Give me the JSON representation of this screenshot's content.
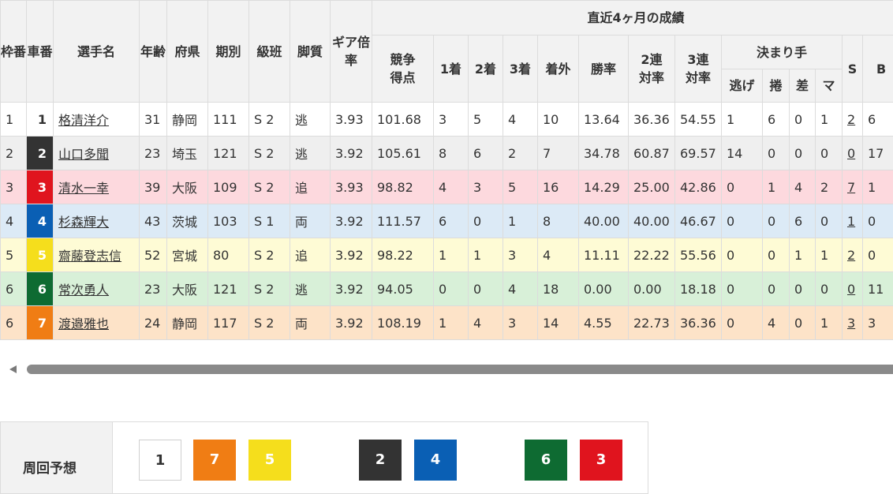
{
  "headers": {
    "waku": "枠番",
    "car": "車番",
    "name": "選手名",
    "age": "年齢",
    "pref": "府県",
    "term": "期別",
    "class": "級班",
    "leg": "脚質",
    "gear": "ギア倍率",
    "recent": "直近4ヶ月の成績",
    "score": "競争得点",
    "first": "1着",
    "second": "2着",
    "third": "3着",
    "out": "着外",
    "win_rate": "勝率",
    "rate2": "2連対率",
    "rate3": "3連対率",
    "kimarite": "決まり手",
    "nige": "逃げ",
    "makuri": "捲",
    "sashi": "差",
    "mark": "マ",
    "s": "S",
    "b": "B"
  },
  "racers": [
    {
      "waku": "1",
      "car": "1",
      "car_bg": "#ffffff",
      "car_fg": "#333333",
      "name": "格清洋介",
      "age": "31",
      "pref": "静岡",
      "term": "111",
      "class": "S 2",
      "leg": "逃",
      "gear": "3.93",
      "score": "101.68",
      "first": "3",
      "second": "5",
      "third": "4",
      "out": "10",
      "win_rate": "13.64",
      "rate2": "36.36",
      "rate3": "54.55",
      "nige": "1",
      "makuri": "6",
      "sashi": "0",
      "mark": "1",
      "s": "2",
      "b": "6"
    },
    {
      "waku": "2",
      "car": "2",
      "car_bg": "#333333",
      "car_fg": "#ffffff",
      "name": "山口多聞",
      "age": "23",
      "pref": "埼玉",
      "term": "121",
      "class": "S 2",
      "leg": "逃",
      "gear": "3.92",
      "score": "105.61",
      "first": "8",
      "second": "6",
      "third": "2",
      "out": "7",
      "win_rate": "34.78",
      "rate2": "60.87",
      "rate3": "69.57",
      "nige": "14",
      "makuri": "0",
      "sashi": "0",
      "mark": "0",
      "s": "0",
      "b": "17"
    },
    {
      "waku": "3",
      "car": "3",
      "car_bg": "#e0141e",
      "car_fg": "#ffffff",
      "name": "清水一幸",
      "age": "39",
      "pref": "大阪",
      "term": "109",
      "class": "S 2",
      "leg": "追",
      "gear": "3.93",
      "score": "98.82",
      "first": "4",
      "second": "3",
      "third": "5",
      "out": "16",
      "win_rate": "14.29",
      "rate2": "25.00",
      "rate3": "42.86",
      "nige": "0",
      "makuri": "1",
      "sashi": "4",
      "mark": "2",
      "s": "7",
      "b": "1"
    },
    {
      "waku": "4",
      "car": "4",
      "car_bg": "#0a5fb4",
      "car_fg": "#ffffff",
      "name": "杉森輝大",
      "age": "43",
      "pref": "茨城",
      "term": "103",
      "class": "S 1",
      "leg": "両",
      "gear": "3.92",
      "score": "111.57",
      "first": "6",
      "second": "0",
      "third": "1",
      "out": "8",
      "win_rate": "40.00",
      "rate2": "40.00",
      "rate3": "46.67",
      "nige": "0",
      "makuri": "0",
      "sashi": "6",
      "mark": "0",
      "s": "1",
      "b": "0"
    },
    {
      "waku": "5",
      "car": "5",
      "car_bg": "#f5de1c",
      "car_fg": "#ffffff",
      "name": "齋藤登志信",
      "age": "52",
      "pref": "宮城",
      "term": "80",
      "class": "S 2",
      "leg": "追",
      "gear": "3.92",
      "score": "98.22",
      "first": "1",
      "second": "1",
      "third": "3",
      "out": "4",
      "win_rate": "11.11",
      "rate2": "22.22",
      "rate3": "55.56",
      "nige": "0",
      "makuri": "0",
      "sashi": "1",
      "mark": "1",
      "s": "2",
      "b": "0"
    },
    {
      "waku": "6",
      "car": "6",
      "car_bg": "#0e6b32",
      "car_fg": "#ffffff",
      "name": "常次勇人",
      "age": "23",
      "pref": "大阪",
      "term": "121",
      "class": "S 2",
      "leg": "逃",
      "gear": "3.92",
      "score": "94.05",
      "first": "0",
      "second": "0",
      "third": "4",
      "out": "18",
      "win_rate": "0.00",
      "rate2": "0.00",
      "rate3": "18.18",
      "nige": "0",
      "makuri": "0",
      "sashi": "0",
      "mark": "0",
      "s": "0",
      "b": "11"
    },
    {
      "waku": "6",
      "car": "7",
      "car_bg": "#f07d14",
      "car_fg": "#ffffff",
      "name": "渡邉雅也",
      "age": "24",
      "pref": "静岡",
      "term": "117",
      "class": "S 2",
      "leg": "両",
      "gear": "3.92",
      "score": "108.19",
      "first": "1",
      "second": "4",
      "third": "3",
      "out": "14",
      "win_rate": "4.55",
      "rate2": "22.73",
      "rate3": "36.36",
      "nige": "0",
      "makuri": "4",
      "sashi": "0",
      "mark": "1",
      "s": "3",
      "b": "3"
    }
  ],
  "forecast": {
    "label": "周回予想",
    "boxes": [
      {
        "num": "1",
        "bg": "#ffffff",
        "fg": "#333333"
      },
      {
        "num": "7",
        "bg": "#f07d14",
        "fg": "#ffffff"
      },
      {
        "num": "5",
        "bg": "#f5de1c",
        "fg": "#ffffff"
      },
      {
        "num": "2",
        "bg": "#333333",
        "fg": "#ffffff"
      },
      {
        "num": "4",
        "bg": "#0a5fb4",
        "fg": "#ffffff"
      },
      {
        "num": "6",
        "bg": "#0e6b32",
        "fg": "#ffffff"
      },
      {
        "num": "3",
        "bg": "#e0141e",
        "fg": "#ffffff"
      }
    ]
  }
}
